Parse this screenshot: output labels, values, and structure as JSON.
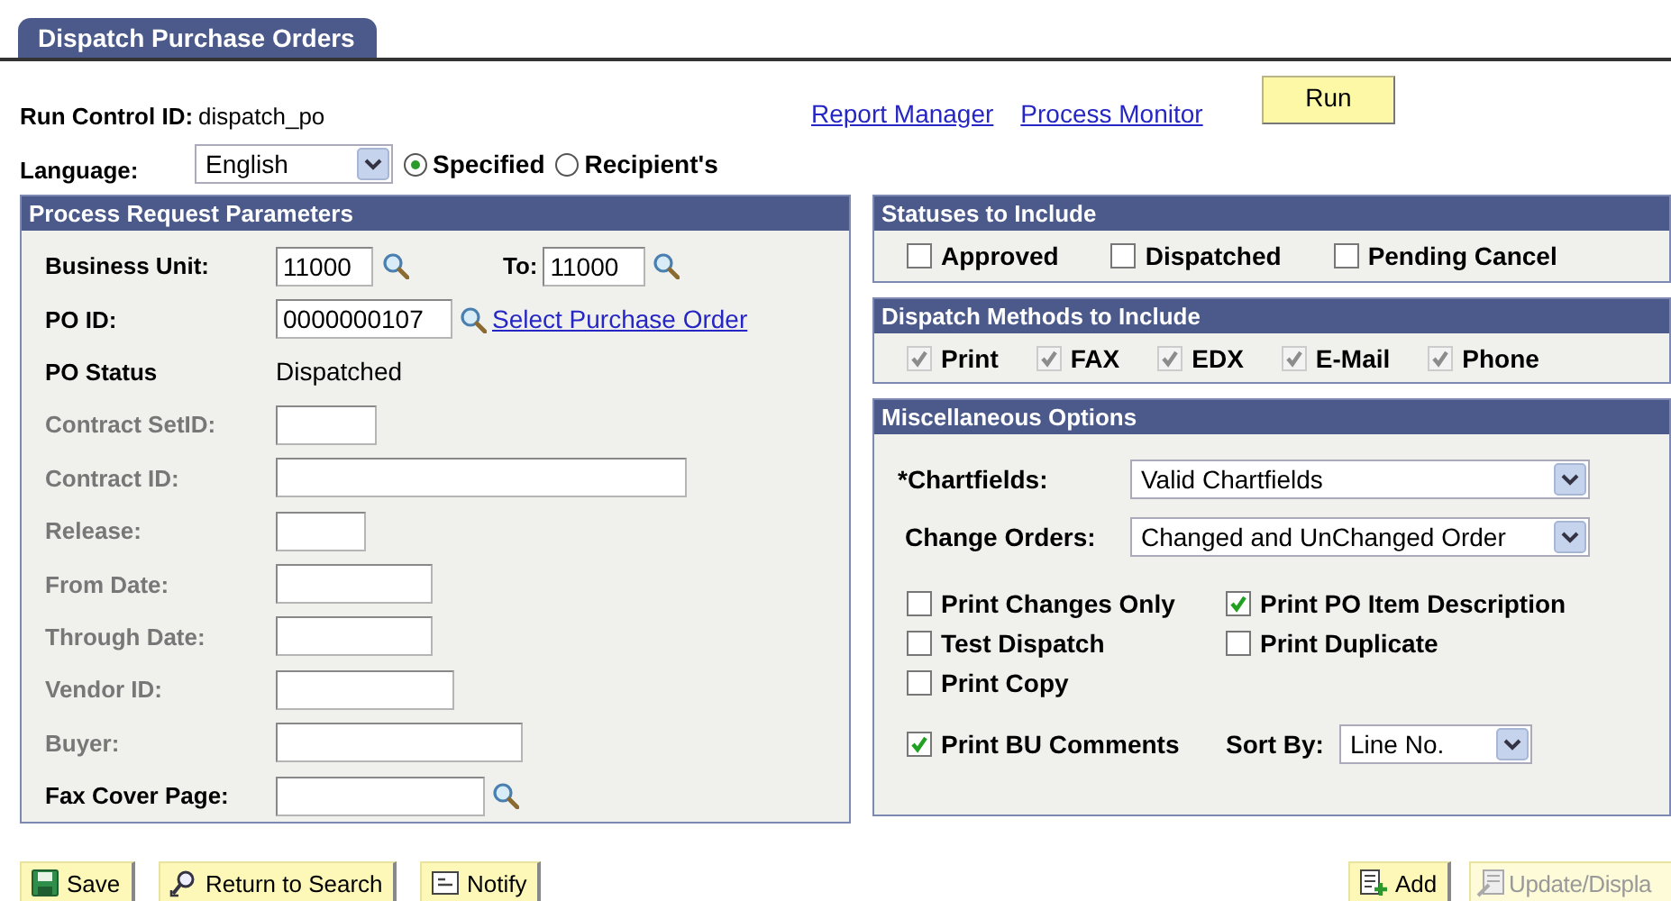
{
  "tab": {
    "label": "Dispatch Purchase Orders",
    "selected": true
  },
  "run_control": {
    "label": "Run Control ID:",
    "value": "dispatch_po"
  },
  "links": [
    "Report Manager",
    "Process Monitor"
  ],
  "run_button": "Run",
  "language": {
    "label": "Language:",
    "value": "English",
    "options": [
      {
        "label": "Specified",
        "selected": true
      },
      {
        "label": "Recipient's",
        "selected": false
      }
    ]
  },
  "process_request": {
    "title": "Process Request Parameters",
    "rows": [
      {
        "kind": "range",
        "label": "Business Unit:",
        "value": "11000",
        "to_label": "To:",
        "to_value": "11000"
      },
      {
        "kind": "lookup",
        "label": "PO ID:",
        "value": "0000000107",
        "link": "Select Purchase Order",
        "disabled": false
      },
      {
        "kind": "display",
        "label": "PO Status",
        "value": "Dispatched"
      },
      {
        "kind": "text",
        "label": "Contract SetID:",
        "disabled": true
      },
      {
        "kind": "text",
        "label": "Contract ID:",
        "disabled": true
      },
      {
        "kind": "text",
        "label": "Release:",
        "disabled": true
      },
      {
        "kind": "text",
        "label": "From Date:",
        "disabled": true
      },
      {
        "kind": "text",
        "label": "Through Date:",
        "disabled": true
      },
      {
        "kind": "text",
        "label": "Vendor ID:",
        "disabled": true
      },
      {
        "kind": "text",
        "label": "Buyer:",
        "disabled": true
      },
      {
        "kind": "lookup",
        "label": "Fax Cover Page:",
        "disabled": false
      }
    ]
  },
  "statuses": {
    "title": "Statuses to Include",
    "items": [
      {
        "label": "Approved",
        "checked": false,
        "disabled": false
      },
      {
        "label": "Dispatched",
        "checked": false,
        "disabled": false
      },
      {
        "label": "Pending Cancel",
        "checked": false,
        "disabled": false
      }
    ]
  },
  "dispatch_methods": {
    "title": "Dispatch Methods to Include",
    "items": [
      {
        "label": "Print",
        "checked": true,
        "disabled": true
      },
      {
        "label": "FAX",
        "checked": true,
        "disabled": true
      },
      {
        "label": "EDX",
        "checked": true,
        "disabled": true
      },
      {
        "label": "E-Mail",
        "checked": true,
        "disabled": true
      },
      {
        "label": "Phone",
        "checked": true,
        "disabled": true
      }
    ]
  },
  "misc": {
    "title": "Miscellaneous Options",
    "chartfields": {
      "label": "*Chartfields:",
      "value": "Valid Chartfields"
    },
    "change_orders": {
      "label": "Change Orders:",
      "value": "Changed and UnChanged Order"
    },
    "options": [
      {
        "label": "Print Changes Only",
        "checked": false,
        "disabled": false
      },
      {
        "label": "Print PO Item Description",
        "checked": true,
        "disabled": false
      },
      {
        "label": "Test Dispatch",
        "checked": false,
        "disabled": false
      },
      {
        "label": "Print Duplicate",
        "checked": false,
        "disabled": false
      },
      {
        "label": "Print Copy",
        "checked": false,
        "disabled": false
      }
    ],
    "bu_comments": {
      "label": "Print BU Comments",
      "checked": true,
      "disabled": false
    },
    "sort_by": {
      "label": "Sort By:",
      "value": "Line No."
    }
  },
  "toolbar_left": [
    {
      "kind": "save",
      "label": "Save",
      "disabled": false
    },
    {
      "kind": "return",
      "label": "Return to Search",
      "disabled": false
    },
    {
      "kind": "notify",
      "label": "Notify",
      "disabled": false
    }
  ],
  "toolbar_right": [
    {
      "kind": "add",
      "label": "Add",
      "disabled": false
    },
    {
      "kind": "update",
      "label": "Update/Displa",
      "disabled": true
    }
  ]
}
